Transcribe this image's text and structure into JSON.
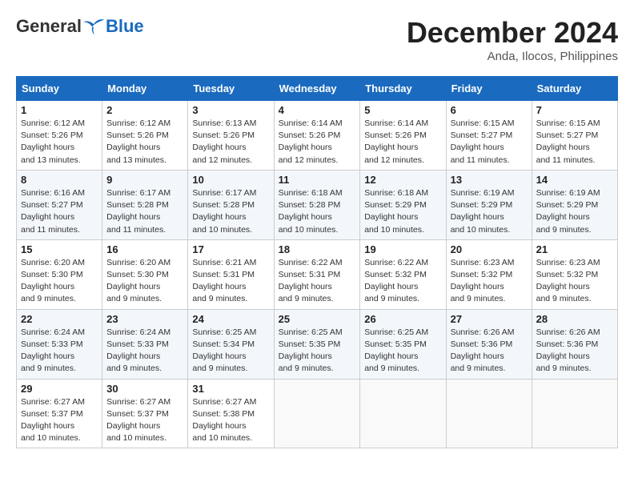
{
  "logo": {
    "general": "General",
    "blue": "Blue"
  },
  "title": "December 2024",
  "subtitle": "Anda, Ilocos, Philippines",
  "headers": [
    "Sunday",
    "Monday",
    "Tuesday",
    "Wednesday",
    "Thursday",
    "Friday",
    "Saturday"
  ],
  "weeks": [
    [
      {
        "day": "1",
        "sunrise": "6:12 AM",
        "sunset": "5:26 PM",
        "daylight": "11 hours and 13 minutes."
      },
      {
        "day": "2",
        "sunrise": "6:12 AM",
        "sunset": "5:26 PM",
        "daylight": "11 hours and 13 minutes."
      },
      {
        "day": "3",
        "sunrise": "6:13 AM",
        "sunset": "5:26 PM",
        "daylight": "11 hours and 12 minutes."
      },
      {
        "day": "4",
        "sunrise": "6:14 AM",
        "sunset": "5:26 PM",
        "daylight": "11 hours and 12 minutes."
      },
      {
        "day": "5",
        "sunrise": "6:14 AM",
        "sunset": "5:26 PM",
        "daylight": "11 hours and 12 minutes."
      },
      {
        "day": "6",
        "sunrise": "6:15 AM",
        "sunset": "5:27 PM",
        "daylight": "11 hours and 11 minutes."
      },
      {
        "day": "7",
        "sunrise": "6:15 AM",
        "sunset": "5:27 PM",
        "daylight": "11 hours and 11 minutes."
      }
    ],
    [
      {
        "day": "8",
        "sunrise": "6:16 AM",
        "sunset": "5:27 PM",
        "daylight": "11 hours and 11 minutes."
      },
      {
        "day": "9",
        "sunrise": "6:17 AM",
        "sunset": "5:28 PM",
        "daylight": "11 hours and 11 minutes."
      },
      {
        "day": "10",
        "sunrise": "6:17 AM",
        "sunset": "5:28 PM",
        "daylight": "11 hours and 10 minutes."
      },
      {
        "day": "11",
        "sunrise": "6:18 AM",
        "sunset": "5:28 PM",
        "daylight": "11 hours and 10 minutes."
      },
      {
        "day": "12",
        "sunrise": "6:18 AM",
        "sunset": "5:29 PM",
        "daylight": "11 hours and 10 minutes."
      },
      {
        "day": "13",
        "sunrise": "6:19 AM",
        "sunset": "5:29 PM",
        "daylight": "11 hours and 10 minutes."
      },
      {
        "day": "14",
        "sunrise": "6:19 AM",
        "sunset": "5:29 PM",
        "daylight": "11 hours and 9 minutes."
      }
    ],
    [
      {
        "day": "15",
        "sunrise": "6:20 AM",
        "sunset": "5:30 PM",
        "daylight": "11 hours and 9 minutes."
      },
      {
        "day": "16",
        "sunrise": "6:20 AM",
        "sunset": "5:30 PM",
        "daylight": "11 hours and 9 minutes."
      },
      {
        "day": "17",
        "sunrise": "6:21 AM",
        "sunset": "5:31 PM",
        "daylight": "11 hours and 9 minutes."
      },
      {
        "day": "18",
        "sunrise": "6:22 AM",
        "sunset": "5:31 PM",
        "daylight": "11 hours and 9 minutes."
      },
      {
        "day": "19",
        "sunrise": "6:22 AM",
        "sunset": "5:32 PM",
        "daylight": "11 hours and 9 minutes."
      },
      {
        "day": "20",
        "sunrise": "6:23 AM",
        "sunset": "5:32 PM",
        "daylight": "11 hours and 9 minutes."
      },
      {
        "day": "21",
        "sunrise": "6:23 AM",
        "sunset": "5:32 PM",
        "daylight": "11 hours and 9 minutes."
      }
    ],
    [
      {
        "day": "22",
        "sunrise": "6:24 AM",
        "sunset": "5:33 PM",
        "daylight": "11 hours and 9 minutes."
      },
      {
        "day": "23",
        "sunrise": "6:24 AM",
        "sunset": "5:33 PM",
        "daylight": "11 hours and 9 minutes."
      },
      {
        "day": "24",
        "sunrise": "6:25 AM",
        "sunset": "5:34 PM",
        "daylight": "11 hours and 9 minutes."
      },
      {
        "day": "25",
        "sunrise": "6:25 AM",
        "sunset": "5:35 PM",
        "daylight": "11 hours and 9 minutes."
      },
      {
        "day": "26",
        "sunrise": "6:25 AM",
        "sunset": "5:35 PM",
        "daylight": "11 hours and 9 minutes."
      },
      {
        "day": "27",
        "sunrise": "6:26 AM",
        "sunset": "5:36 PM",
        "daylight": "11 hours and 9 minutes."
      },
      {
        "day": "28",
        "sunrise": "6:26 AM",
        "sunset": "5:36 PM",
        "daylight": "11 hours and 9 minutes."
      }
    ],
    [
      {
        "day": "29",
        "sunrise": "6:27 AM",
        "sunset": "5:37 PM",
        "daylight": "11 hours and 10 minutes."
      },
      {
        "day": "30",
        "sunrise": "6:27 AM",
        "sunset": "5:37 PM",
        "daylight": "11 hours and 10 minutes."
      },
      {
        "day": "31",
        "sunrise": "6:27 AM",
        "sunset": "5:38 PM",
        "daylight": "11 hours and 10 minutes."
      },
      null,
      null,
      null,
      null
    ]
  ]
}
